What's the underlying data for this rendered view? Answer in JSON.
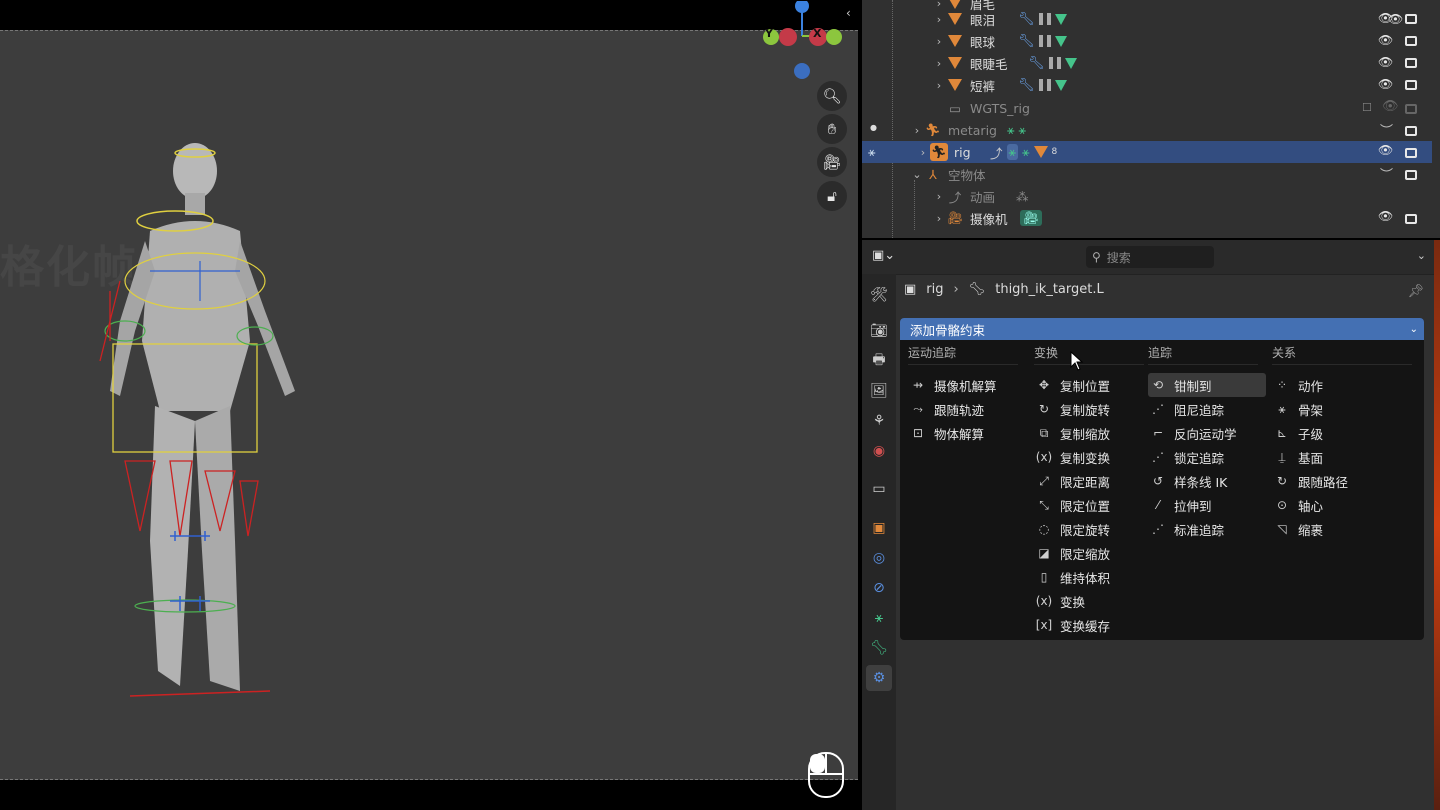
{
  "viewport": {
    "watermark": "格化帧",
    "gizmo": {
      "z": "Z",
      "y": "Y",
      "x": "X"
    },
    "colors": {
      "x_axis": "#e0424f",
      "y_axis": "#8cc63e",
      "z_axis": "#3b82e0"
    }
  },
  "outliner": {
    "rows": [
      {
        "label": "眉毛",
        "type": "mesh"
      },
      {
        "label": "眼泪",
        "type": "mesh"
      },
      {
        "label": "眼球",
        "type": "mesh"
      },
      {
        "label": "眼睫毛",
        "type": "mesh"
      },
      {
        "label": "短裤",
        "type": "mesh"
      },
      {
        "label": "WGTS_rig",
        "type": "collection"
      },
      {
        "label": "metarig",
        "type": "armature"
      },
      {
        "label": "rig",
        "type": "armature",
        "badge": "8"
      },
      {
        "label": "空物体",
        "type": "empty"
      },
      {
        "label": "动画",
        "type": "action"
      },
      {
        "label": "摄像机",
        "type": "camera"
      }
    ]
  },
  "properties": {
    "search_placeholder": "搜索",
    "breadcrumb": {
      "object": "rig",
      "bone": "thigh_ik_target.L"
    },
    "menu": {
      "title": "添加骨骼约束",
      "columns": [
        {
          "header": "运动追踪",
          "items": [
            "摄像机解算",
            "跟随轨迹",
            "物体解算"
          ]
        },
        {
          "header": "变换",
          "items": [
            "复制位置",
            "复制旋转",
            "复制缩放",
            "复制变换",
            "限定距离",
            "限定位置",
            "限定旋转",
            "限定缩放",
            "维持体积",
            "变换",
            "变换缓存"
          ]
        },
        {
          "header": "追踪",
          "items": [
            "钳制到",
            "阻尼追踪",
            "反向运动学",
            "锁定追踪",
            "样条线 IK",
            "拉伸到",
            "标准追踪"
          ]
        },
        {
          "header": "关系",
          "items": [
            "动作",
            "骨架",
            "子级",
            "基面",
            "跟随路径",
            "轴心",
            "缩裹"
          ]
        }
      ],
      "highlighted": "钳制到"
    }
  },
  "colors": {
    "accent": "#4470b3",
    "selected_row": "#334d80",
    "mesh_icon": "#e0883a"
  }
}
